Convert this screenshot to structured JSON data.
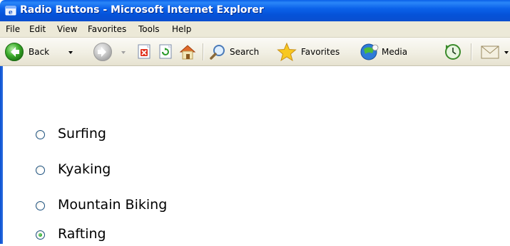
{
  "window": {
    "title": "Radio Buttons - Microsoft Internet Explorer",
    "icon": "ie-icon"
  },
  "menu": {
    "items": [
      "File",
      "Edit",
      "View",
      "Favorites",
      "Tools",
      "Help"
    ]
  },
  "toolbar": {
    "back_label": "Back",
    "search_label": "Search",
    "favorites_label": "Favorites",
    "media_label": "Media",
    "icons": [
      "back-arrow-icon",
      "forward-arrow-icon",
      "stop-icon",
      "refresh-icon",
      "home-icon",
      "search-icon",
      "favorites-star-icon",
      "media-icon",
      "history-icon",
      "mail-icon"
    ]
  },
  "radio_group": {
    "options": [
      {
        "label": "Surfing",
        "checked": false
      },
      {
        "label": "Kyaking",
        "checked": false
      },
      {
        "label": "Mountain Biking",
        "checked": false
      },
      {
        "label": "Rafting",
        "checked": true
      }
    ]
  },
  "colors": {
    "titlebar": "#0a5fe8",
    "menubar": "#ece9d8",
    "radio_checked": "#21a121"
  }
}
